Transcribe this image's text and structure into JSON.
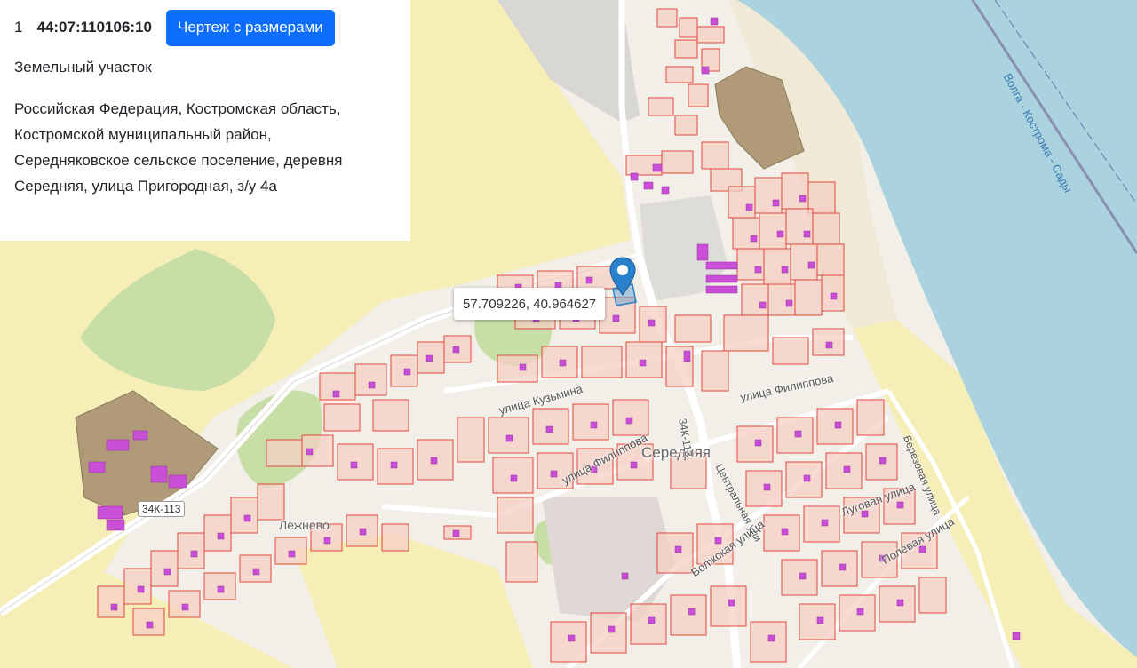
{
  "info": {
    "index": "1",
    "cadastral_number": "44:07:110106:10",
    "drawing_button_label": "Чертеж с размерами",
    "object_type": "Земельный участок",
    "address_lines": [
      "Российская Федерация, Костромская область,",
      "Костромской муниципальный район,",
      "Середняковское сельское поселение, деревня",
      "Середняя, улица Пригородная, з/у 4а"
    ]
  },
  "popup": {
    "coordinates": "57.709226, 40.964627"
  },
  "map_labels": {
    "river": "Волга · Кострома - Сады",
    "settlement_main": "Середняя",
    "settlement_west": "Лежнево",
    "road_code_west": "34К-113",
    "road_code_center": "34К-113",
    "street_kuzmina": "улица Кузьмина",
    "street_filippova_1": "улица Филиппова",
    "street_filippova_2": "улица Филиппова",
    "street_tsentralnaya": "Центральная ули",
    "street_volzhskaya": "Волжская улица",
    "street_lugovaya": "Луговая улица",
    "street_polevaya": "Полевая улица",
    "street_bereznaya": "Березовая улица"
  },
  "colors": {
    "water": "#aad3df",
    "field": "#f5eeb6",
    "forest": "#c7dfa6",
    "parcel_stroke": "#e0483c",
    "parcel_fill": "#f6cfc4",
    "building": "#c84fd6",
    "industrial": "#b09a77",
    "marker": "#2a81cb",
    "button": "#0d6efd"
  }
}
